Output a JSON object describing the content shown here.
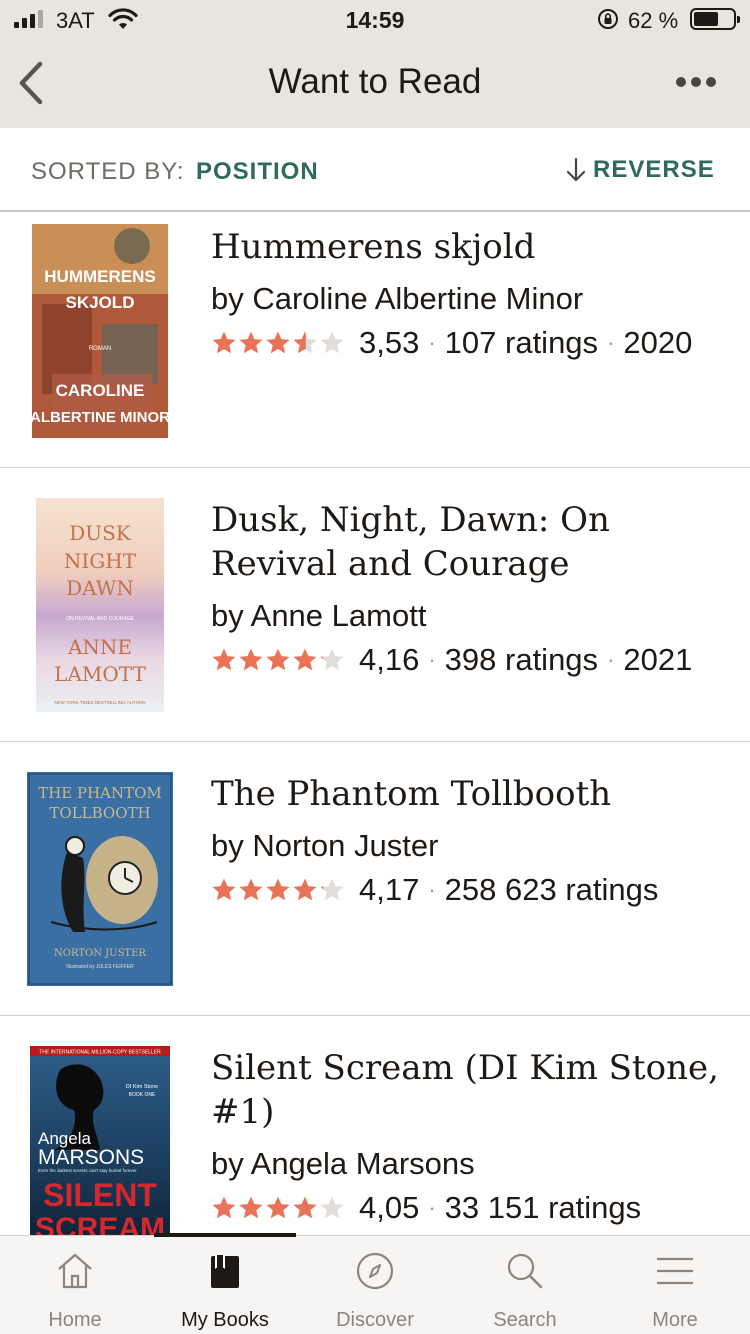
{
  "status_bar": {
    "carrier": "3AT",
    "time": "14:59",
    "battery_percent": "62 %",
    "battery_level": 0.62
  },
  "header": {
    "title": "Want to Read",
    "back_icon": "chevron-left-icon",
    "more_icon": "ellipsis-icon"
  },
  "sort": {
    "label": "SORTED BY:",
    "value": "POSITION",
    "reverse_label": "REVERSE"
  },
  "books": [
    {
      "title": "Hummerens skjold",
      "author": "by Caroline Albertine Minor",
      "rating": "3,53",
      "rating_value": 3.53,
      "ratings_count": "107 ratings",
      "year": "2020",
      "cover": {
        "top": "HUMMERENS",
        "top2": "SKJOLD",
        "sub": "ROMAN",
        "bottom": "CAROLINE",
        "bottom2": "ALBERTINE MINOR"
      }
    },
    {
      "title": "Dusk, Night, Dawn: On Revival and Courage",
      "author": "by Anne Lamott",
      "rating": "4,16",
      "rating_value": 4.16,
      "ratings_count": "398 ratings",
      "year": "2021",
      "cover": {
        "l1": "DUSK",
        "l2": "NIGHT",
        "l3": "DAWN",
        "sub": "ON REVIVAL AND COURAGE",
        "a1": "ANNE",
        "a2": "LAMOTT",
        "tag": "NEW YORK TIMES BESTSELLING AUTHOR"
      }
    },
    {
      "title": "The Phantom Tollbooth",
      "author": "by Norton Juster",
      "rating": "4,17",
      "rating_value": 4.17,
      "ratings_count": "258 623 ratings",
      "year": "",
      "cover": {
        "l1": "THE PHANTOM",
        "l2": "TOLLBOOTH",
        "author": "NORTON JUSTER",
        "illus": "Illustrated by JULES FEIFFER"
      }
    },
    {
      "title": "Silent Scream (DI Kim Stone, #1)",
      "author": "by Angela Marsons",
      "rating": "4,05",
      "rating_value": 4.05,
      "ratings_count": "33 151 ratings",
      "year": "",
      "cover": {
        "banner": "THE INTERNATIONAL MILLION-COPY BESTSELLER",
        "series": "DI Kim Stone",
        "book": "BOOK ONE",
        "a1": "Angela",
        "a2": "MARSONS",
        "tagline": "Even the darkest secrets can't stay buried forever.",
        "t1": "SILENT",
        "t2": "SCREAM"
      }
    }
  ],
  "tabs": [
    {
      "label": "Home",
      "icon": "home-icon",
      "active": false
    },
    {
      "label": "My Books",
      "icon": "book-icon",
      "active": true
    },
    {
      "label": "Discover",
      "icon": "compass-icon",
      "active": false
    },
    {
      "label": "Search",
      "icon": "search-icon",
      "active": false
    },
    {
      "label": "More",
      "icon": "menu-icon",
      "active": false
    }
  ],
  "colors": {
    "header_bg": "#e8e6dc",
    "accent": "#2f6a5a",
    "star": "#e87359",
    "star_empty": "#e1ded9"
  }
}
